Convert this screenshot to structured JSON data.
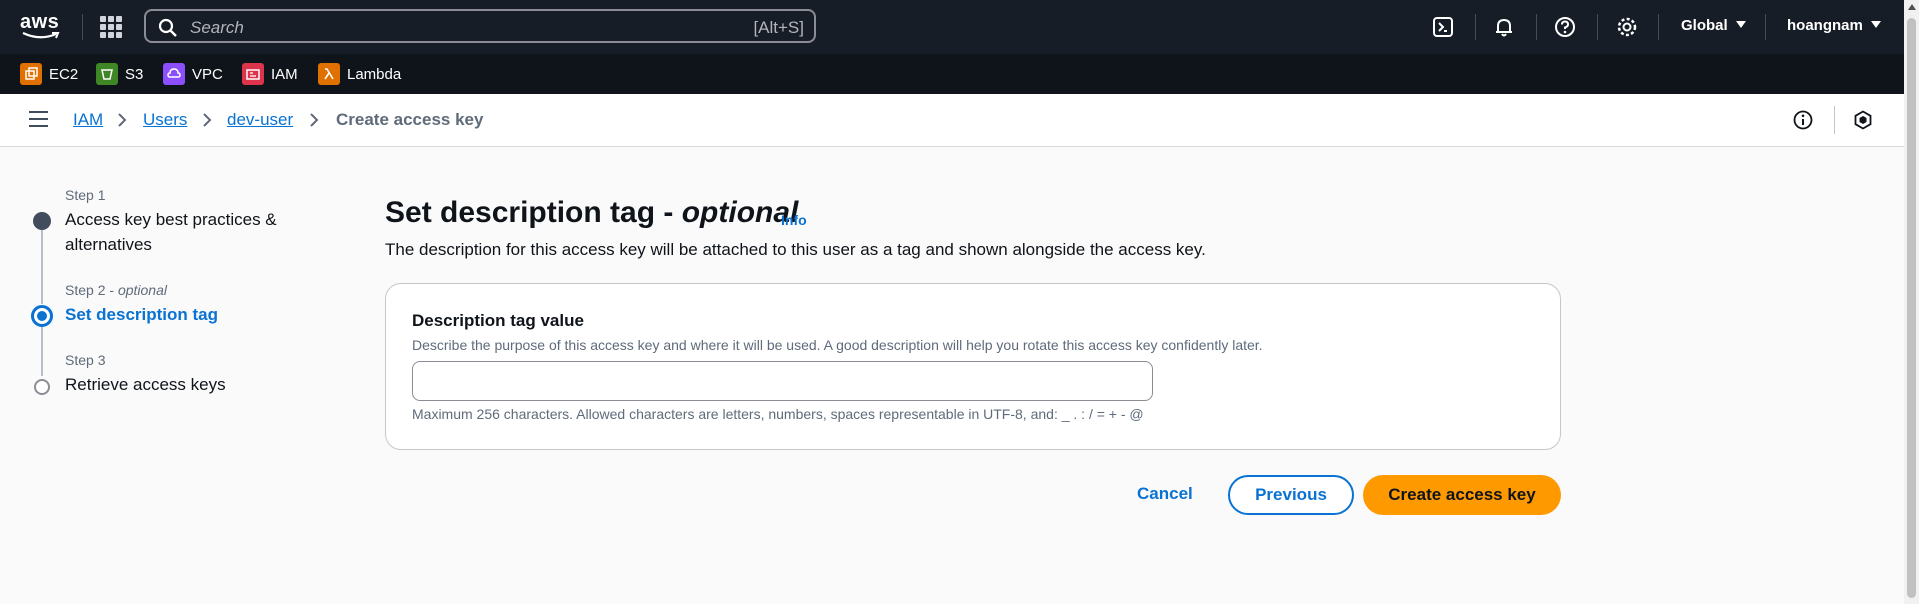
{
  "topbar": {
    "logo_text": "aws",
    "search_placeholder": "Search",
    "search_shortcut": "[Alt+S]",
    "region": "Global",
    "user": "hoangnam",
    "icons": [
      "cloudshell-icon",
      "bell-icon",
      "help-icon",
      "settings-icon"
    ]
  },
  "favorites": [
    {
      "label": "EC2",
      "icon": "ec2-icon",
      "color": "#e07000"
    },
    {
      "label": "S3",
      "icon": "s3-icon",
      "color": "#3f8624"
    },
    {
      "label": "VPC",
      "icon": "vpc-icon",
      "color": "#8c4fff"
    },
    {
      "label": "IAM",
      "icon": "iam-icon",
      "color": "#dd344c"
    },
    {
      "label": "Lambda",
      "icon": "lambda-icon",
      "color": "#e07000"
    }
  ],
  "breadcrumb": {
    "items": [
      "IAM",
      "Users",
      "dev-user"
    ],
    "current": "Create access key"
  },
  "steps": [
    {
      "number": "Step 1",
      "title": "Access key best practices & alternatives",
      "title_line1": "Access key best practices &",
      "title_line2": "alternatives",
      "state": "completed"
    },
    {
      "number": "Step 2",
      "optional": "optional",
      "title": "Set description tag",
      "state": "active"
    },
    {
      "number": "Step 3",
      "title": "Retrieve access keys",
      "state": "pending"
    }
  ],
  "page": {
    "title": "Set description tag -",
    "title_optional": "optional",
    "info_link": "Info",
    "description": "The description for this access key will be attached to this user as a tag and shown alongside the access key."
  },
  "form": {
    "label": "Description tag value",
    "description": "Describe the purpose of this access key and where it will be used. A good description will help you rotate this access key confidently later.",
    "value": "",
    "constraint": "Maximum 256 characters. Allowed characters are letters, numbers, spaces representable in UTF-8, and: _ . : / = + - @"
  },
  "actions": {
    "cancel": "Cancel",
    "previous": "Previous",
    "create": "Create access key"
  },
  "colors": {
    "primary": "#ff9900",
    "link": "#0972d3",
    "topbar": "#161d26"
  }
}
